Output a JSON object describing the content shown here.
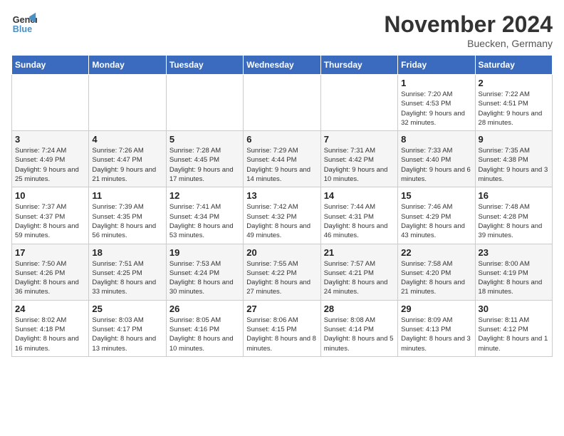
{
  "logo": {
    "line1": "General",
    "line2": "Blue"
  },
  "title": "November 2024",
  "subtitle": "Buecken, Germany",
  "weekdays": [
    "Sunday",
    "Monday",
    "Tuesday",
    "Wednesday",
    "Thursday",
    "Friday",
    "Saturday"
  ],
  "weeks": [
    [
      {
        "day": "",
        "info": ""
      },
      {
        "day": "",
        "info": ""
      },
      {
        "day": "",
        "info": ""
      },
      {
        "day": "",
        "info": ""
      },
      {
        "day": "",
        "info": ""
      },
      {
        "day": "1",
        "info": "Sunrise: 7:20 AM\nSunset: 4:53 PM\nDaylight: 9 hours and 32 minutes."
      },
      {
        "day": "2",
        "info": "Sunrise: 7:22 AM\nSunset: 4:51 PM\nDaylight: 9 hours and 28 minutes."
      }
    ],
    [
      {
        "day": "3",
        "info": "Sunrise: 7:24 AM\nSunset: 4:49 PM\nDaylight: 9 hours and 25 minutes."
      },
      {
        "day": "4",
        "info": "Sunrise: 7:26 AM\nSunset: 4:47 PM\nDaylight: 9 hours and 21 minutes."
      },
      {
        "day": "5",
        "info": "Sunrise: 7:28 AM\nSunset: 4:45 PM\nDaylight: 9 hours and 17 minutes."
      },
      {
        "day": "6",
        "info": "Sunrise: 7:29 AM\nSunset: 4:44 PM\nDaylight: 9 hours and 14 minutes."
      },
      {
        "day": "7",
        "info": "Sunrise: 7:31 AM\nSunset: 4:42 PM\nDaylight: 9 hours and 10 minutes."
      },
      {
        "day": "8",
        "info": "Sunrise: 7:33 AM\nSunset: 4:40 PM\nDaylight: 9 hours and 6 minutes."
      },
      {
        "day": "9",
        "info": "Sunrise: 7:35 AM\nSunset: 4:38 PM\nDaylight: 9 hours and 3 minutes."
      }
    ],
    [
      {
        "day": "10",
        "info": "Sunrise: 7:37 AM\nSunset: 4:37 PM\nDaylight: 8 hours and 59 minutes."
      },
      {
        "day": "11",
        "info": "Sunrise: 7:39 AM\nSunset: 4:35 PM\nDaylight: 8 hours and 56 minutes."
      },
      {
        "day": "12",
        "info": "Sunrise: 7:41 AM\nSunset: 4:34 PM\nDaylight: 8 hours and 53 minutes."
      },
      {
        "day": "13",
        "info": "Sunrise: 7:42 AM\nSunset: 4:32 PM\nDaylight: 8 hours and 49 minutes."
      },
      {
        "day": "14",
        "info": "Sunrise: 7:44 AM\nSunset: 4:31 PM\nDaylight: 8 hours and 46 minutes."
      },
      {
        "day": "15",
        "info": "Sunrise: 7:46 AM\nSunset: 4:29 PM\nDaylight: 8 hours and 43 minutes."
      },
      {
        "day": "16",
        "info": "Sunrise: 7:48 AM\nSunset: 4:28 PM\nDaylight: 8 hours and 39 minutes."
      }
    ],
    [
      {
        "day": "17",
        "info": "Sunrise: 7:50 AM\nSunset: 4:26 PM\nDaylight: 8 hours and 36 minutes."
      },
      {
        "day": "18",
        "info": "Sunrise: 7:51 AM\nSunset: 4:25 PM\nDaylight: 8 hours and 33 minutes."
      },
      {
        "day": "19",
        "info": "Sunrise: 7:53 AM\nSunset: 4:24 PM\nDaylight: 8 hours and 30 minutes."
      },
      {
        "day": "20",
        "info": "Sunrise: 7:55 AM\nSunset: 4:22 PM\nDaylight: 8 hours and 27 minutes."
      },
      {
        "day": "21",
        "info": "Sunrise: 7:57 AM\nSunset: 4:21 PM\nDaylight: 8 hours and 24 minutes."
      },
      {
        "day": "22",
        "info": "Sunrise: 7:58 AM\nSunset: 4:20 PM\nDaylight: 8 hours and 21 minutes."
      },
      {
        "day": "23",
        "info": "Sunrise: 8:00 AM\nSunset: 4:19 PM\nDaylight: 8 hours and 18 minutes."
      }
    ],
    [
      {
        "day": "24",
        "info": "Sunrise: 8:02 AM\nSunset: 4:18 PM\nDaylight: 8 hours and 16 minutes."
      },
      {
        "day": "25",
        "info": "Sunrise: 8:03 AM\nSunset: 4:17 PM\nDaylight: 8 hours and 13 minutes."
      },
      {
        "day": "26",
        "info": "Sunrise: 8:05 AM\nSunset: 4:16 PM\nDaylight: 8 hours and 10 minutes."
      },
      {
        "day": "27",
        "info": "Sunrise: 8:06 AM\nSunset: 4:15 PM\nDaylight: 8 hours and 8 minutes."
      },
      {
        "day": "28",
        "info": "Sunrise: 8:08 AM\nSunset: 4:14 PM\nDaylight: 8 hours and 5 minutes."
      },
      {
        "day": "29",
        "info": "Sunrise: 8:09 AM\nSunset: 4:13 PM\nDaylight: 8 hours and 3 minutes."
      },
      {
        "day": "30",
        "info": "Sunrise: 8:11 AM\nSunset: 4:12 PM\nDaylight: 8 hours and 1 minute."
      }
    ]
  ]
}
